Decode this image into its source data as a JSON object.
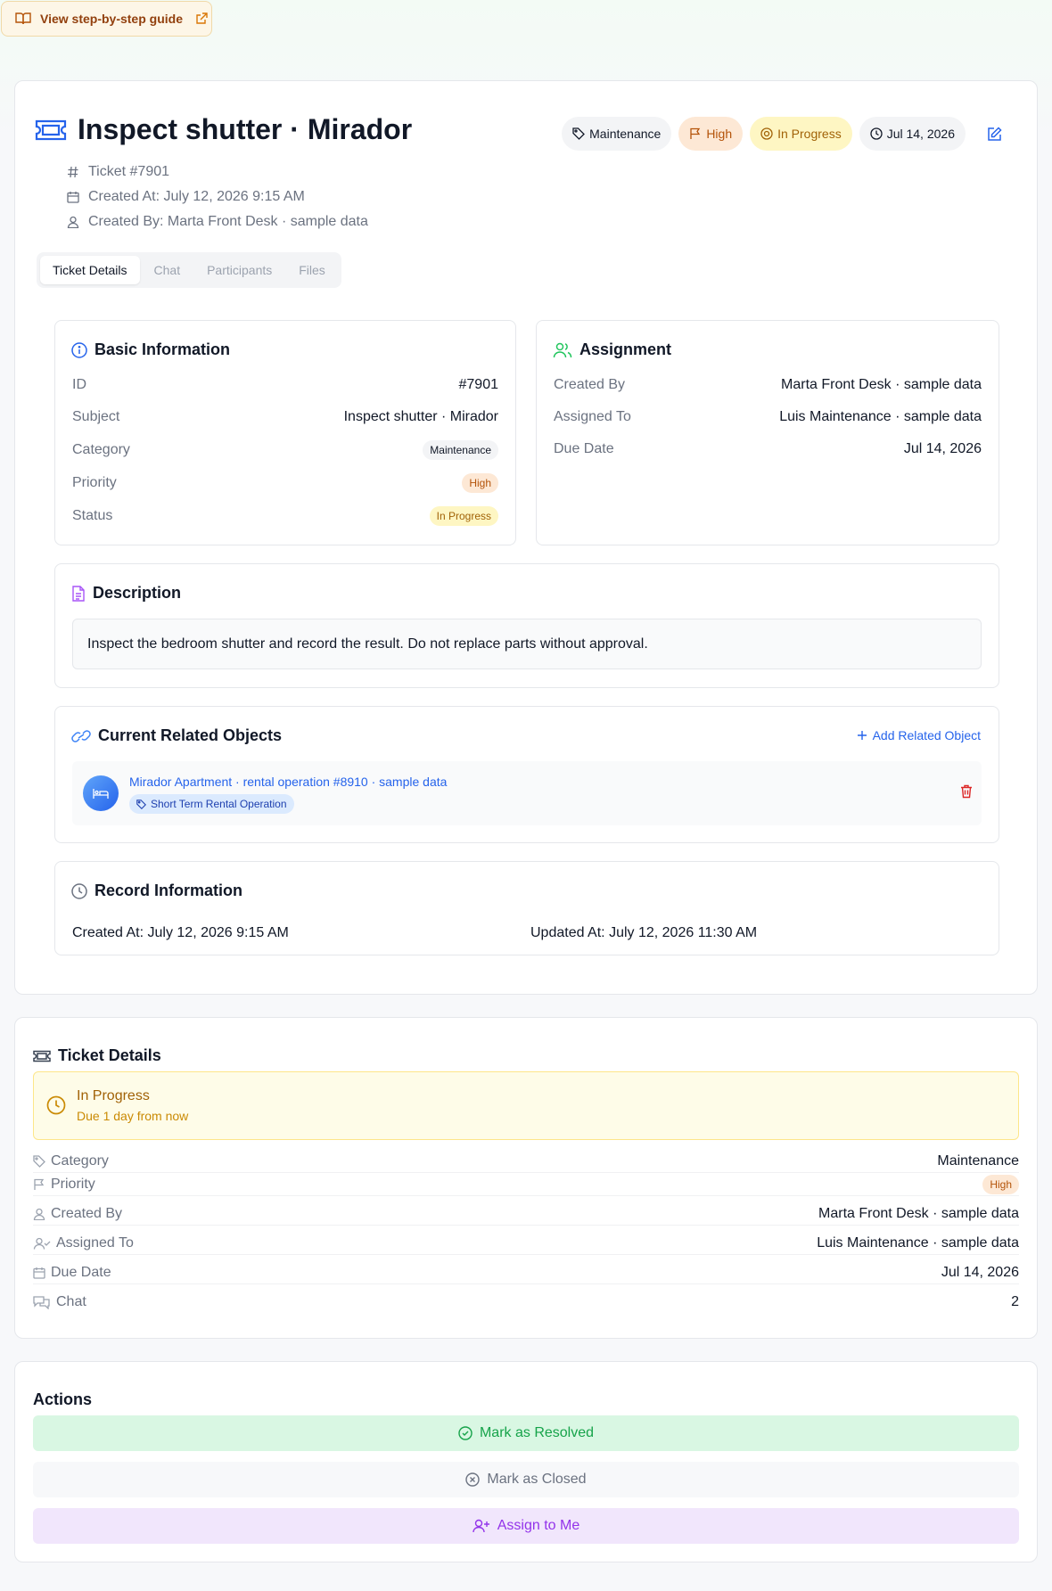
{
  "guide": {
    "label": "View step-by-step guide"
  },
  "ticket": {
    "title": "Inspect shutter · Mirador",
    "number": "Ticket #7901",
    "created_at": "Created At: July 12, 2026 9:15 AM",
    "created_by": "Created By: Marta Front Desk · sample data"
  },
  "badges": {
    "category": "Maintenance",
    "priority": "High",
    "status": "In Progress",
    "due": "Jul 14, 2026"
  },
  "tabs": [
    "Ticket Details",
    "Chat",
    "Participants",
    "Files"
  ],
  "basic": {
    "heading": "Basic Information",
    "rows": [
      {
        "label": "ID",
        "value": "#7901"
      },
      {
        "label": "Subject",
        "value": "Inspect shutter · Mirador"
      },
      {
        "label": "Category",
        "value": "Maintenance"
      },
      {
        "label": "Priority",
        "value": "High"
      },
      {
        "label": "Status",
        "value": "In Progress"
      }
    ]
  },
  "assignment": {
    "heading": "Assignment",
    "rows": [
      {
        "label": "Created By",
        "value": "Marta Front Desk · sample data"
      },
      {
        "label": "Assigned To",
        "value": "Luis Maintenance · sample data"
      },
      {
        "label": "Due Date",
        "value": "Jul 14, 2026"
      }
    ]
  },
  "description": {
    "heading": "Description",
    "text": "Inspect the bedroom shutter and record the result. Do not replace parts without approval."
  },
  "related": {
    "heading": "Current Related Objects",
    "add_label": "Add Related Object",
    "item_title": "Mirador Apartment · rental operation #8910 · sample data",
    "item_tag": "Short Term Rental Operation"
  },
  "record": {
    "heading": "Record Information",
    "created": "Created At: July 12, 2026 9:15 AM",
    "updated": "Updated At: July 12, 2026 11:30 AM"
  },
  "details": {
    "heading": "Ticket Details",
    "status_title": "In Progress",
    "status_sub": "Due 1 day from now",
    "rows": [
      {
        "label": "Category",
        "value": "Maintenance"
      },
      {
        "label": "Priority",
        "value": "High"
      },
      {
        "label": "Created By",
        "value": "Marta Front Desk · sample data"
      },
      {
        "label": "Assigned To",
        "value": "Luis Maintenance · sample data"
      },
      {
        "label": "Due Date",
        "value": "Jul 14, 2026"
      },
      {
        "label": "Chat",
        "value": "2"
      }
    ]
  },
  "actions": {
    "heading": "Actions",
    "resolve": "Mark as Resolved",
    "close": "Mark as Closed",
    "assign": "Assign to Me"
  },
  "colors": {
    "accent_blue": "#2563eb",
    "resolve_green": "#16a34a",
    "assign_purple": "#9333ea",
    "warning_amber": "#a16207"
  },
  "icons": [
    "book-icon",
    "external-link-icon",
    "ticket-icon",
    "tag-icon",
    "flag-icon",
    "in-progress-icon",
    "clock-icon",
    "edit-icon",
    "hash-icon",
    "calendar-icon",
    "user-icon",
    "info-icon",
    "users-icon",
    "file-text-icon",
    "link-icon",
    "plus-icon",
    "bed-icon",
    "trash-icon",
    "user-check-icon",
    "chat-icon",
    "check-circle-icon",
    "x-circle-icon",
    "user-plus-icon"
  ]
}
